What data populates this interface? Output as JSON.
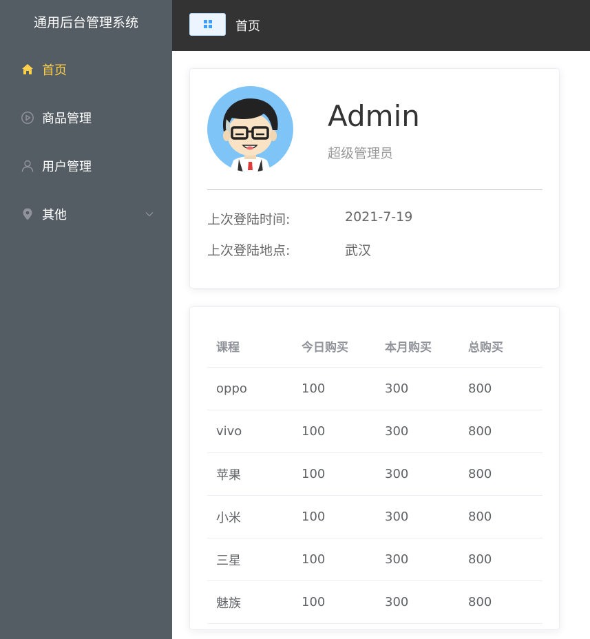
{
  "sidebar": {
    "title": "通用后台管理系统",
    "items": [
      {
        "label": "首页",
        "icon": "home-icon"
      },
      {
        "label": "商品管理",
        "icon": "video-play-icon"
      },
      {
        "label": "用户管理",
        "icon": "user-icon"
      },
      {
        "label": "其他",
        "icon": "location-icon",
        "has_submenu": true
      }
    ]
  },
  "header": {
    "menu_button_icon": "menu-grid-icon",
    "breadcrumb": "首页"
  },
  "user_card": {
    "name": "Admin",
    "role": "超级管理员",
    "last_login_time_label": "上次登陆时间:",
    "last_login_time": "2021-7-19",
    "last_login_place_label": "上次登陆地点:",
    "last_login_place": "武汉"
  },
  "table": {
    "headers": [
      "课程",
      "今日购买",
      "本月购买",
      "总购买"
    ],
    "rows": [
      [
        "oppo",
        "100",
        "300",
        "800"
      ],
      [
        "vivo",
        "100",
        "300",
        "800"
      ],
      [
        "苹果",
        "100",
        "300",
        "800"
      ],
      [
        "小米",
        "100",
        "300",
        "800"
      ],
      [
        "三星",
        "100",
        "300",
        "800"
      ],
      [
        "魅族",
        "100",
        "300",
        "800"
      ]
    ]
  },
  "colors": {
    "sidebar_bg": "#545c64",
    "active_menu": "#ffd04b",
    "header_bg": "#333333",
    "button_bg": "#ecf5ff",
    "accent": "#409eff"
  }
}
